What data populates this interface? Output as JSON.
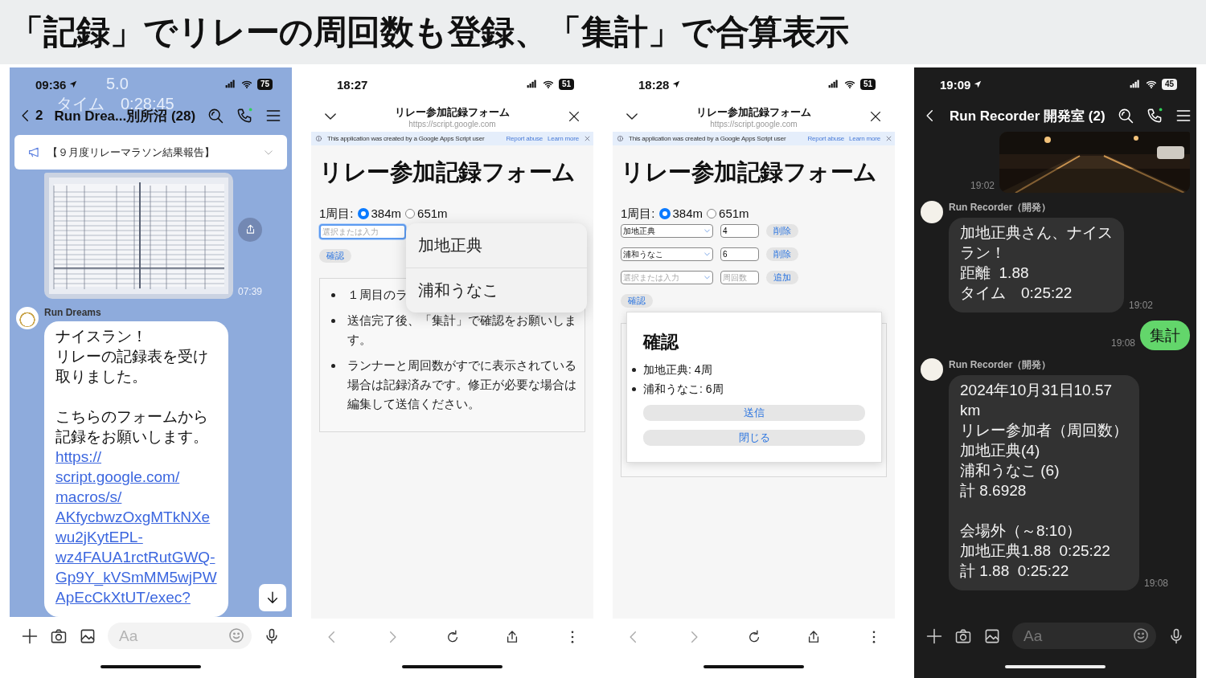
{
  "title": "「記録」でリレーの周回数も登録、「集計」で合算表示",
  "screens": [
    {
      "kind": "chat",
      "status_bar": {
        "time": "09:36",
        "location": true,
        "battery": "75"
      },
      "underlay_lines": [
        "5.0",
        "タイム　0:28:45"
      ],
      "header": {
        "back_count": "2",
        "title": "Run Drea...別所沼 (28)"
      },
      "announcement": "【９月度リレーマラソン結果報告】",
      "messages": [
        {
          "time": "07:39",
          "outgoing": false,
          "share": true
        },
        {
          "kind": "text",
          "sender": "Run Dreams",
          "paragraphs": [
            [
              "ナイスラン！",
              "リレーの記録表を受け",
              "取りました。"
            ],
            [
              "こちらのフォームから",
              "記録をお願いします。"
            ]
          ],
          "link_lines": [
            "https://",
            "script.google.com/",
            "macros/s/",
            "AKfycbwzOxgMTkNXe",
            "wu2jKytEPL-",
            "wz4FAUA1rctRutGWQ-",
            "Gp9Y_kVSmMM5wjPW",
            "ApEcCkXtUT/exec?"
          ],
          "outgoing": false
        }
      ],
      "scroll_down": true,
      "composer": {
        "placeholder": "Aa"
      }
    },
    {
      "kind": "form",
      "status_bar": {
        "time": "18:27",
        "battery": "51"
      },
      "browser": {
        "title": "リレー参加記録フォーム",
        "url": "https://script.google.com"
      },
      "notice": {
        "text": "This application was created by a Google Apps Script user",
        "links": [
          "Report abuse",
          "Learn more"
        ]
      },
      "heading": "リレー参加記録フォーム",
      "lap": {
        "label": "1周目:",
        "options": [
          {
            "label": "384m",
            "selected": true
          },
          {
            "label": "651m",
            "selected": false
          }
        ]
      },
      "entries": [
        {
          "kind": "combo",
          "placeholder": "選択または入力",
          "focused": true
        }
      ],
      "confirm_button": "確認",
      "notes": [
        "１周目のラ",
        "送信完了後、「集計」で確認をお願いします。",
        "ランナーと周回数がすでに表示されている場合は記録済みです。修正が必要な場合は編集して送信ください。"
      ],
      "dropdown": {
        "options": [
          "加地正典",
          "浦和うなこ"
        ]
      }
    },
    {
      "kind": "form",
      "status_bar": {
        "time": "18:28",
        "location": true,
        "battery": "51"
      },
      "browser": {
        "title": "リレー参加記録フォーム",
        "url": "https://script.google.com"
      },
      "notice": {
        "text": "This application was created by a Google Apps Script user",
        "links": [
          "Report abuse",
          "Learn more"
        ]
      },
      "heading": "リレー参加記録フォーム",
      "lap": {
        "label": "1周目:",
        "options": [
          {
            "label": "384m",
            "selected": true
          },
          {
            "label": "651m",
            "selected": false
          }
        ]
      },
      "entries": [
        {
          "kind": "row",
          "runner": "加地正典",
          "laps": "4",
          "button": "削除"
        },
        {
          "kind": "row",
          "runner": "浦和うなこ",
          "laps": "6",
          "button": "削除"
        },
        {
          "kind": "row",
          "runner_placeholder": "選択または入力",
          "laps_placeholder": "周回数",
          "button": "追加"
        }
      ],
      "confirm_button": "確認",
      "dialog": {
        "title": "確認",
        "items": [
          "加地正典: 4周",
          "浦和うなこ: 6周"
        ],
        "buttons": [
          "送信",
          "閉じる"
        ]
      }
    },
    {
      "kind": "chat_dark",
      "status_bar": {
        "time": "19:09",
        "location": true,
        "battery": "45"
      },
      "header": {
        "title": "Run Recorder 開発室 (2)"
      },
      "messages": [
        {
          "time": "19:02",
          "outgoing": true
        },
        {
          "kind": "text",
          "sender": "Run Recorder（開発）",
          "paragraphs": [
            [
              "加地正典さん、ナイス",
              "ラン！",
              "距離  1.88",
              "タイム　0:25:22"
            ]
          ],
          "time": "19:02",
          "outgoing": false
        },
        {
          "kind": "text",
          "paragraphs": [
            [
              "集計"
            ]
          ],
          "time": "19:08",
          "outgoing": true
        },
        {
          "kind": "text",
          "sender": "Run Recorder（開発）",
          "paragraphs": [
            [
              "2024年10月31日10.57",
              "km",
              "リレー参加者（周回数）",
              "加地正典(4)",
              "浦和うなこ (6)",
              "計 8.6928"
            ],
            [
              "会場外（～8:10）",
              "加地正典1.88  0:25:22",
              "計 1.88  0:25:22"
            ]
          ],
          "time": "19:08",
          "outgoing": false
        }
      ],
      "composer": {
        "placeholder": "Aa"
      }
    }
  ]
}
